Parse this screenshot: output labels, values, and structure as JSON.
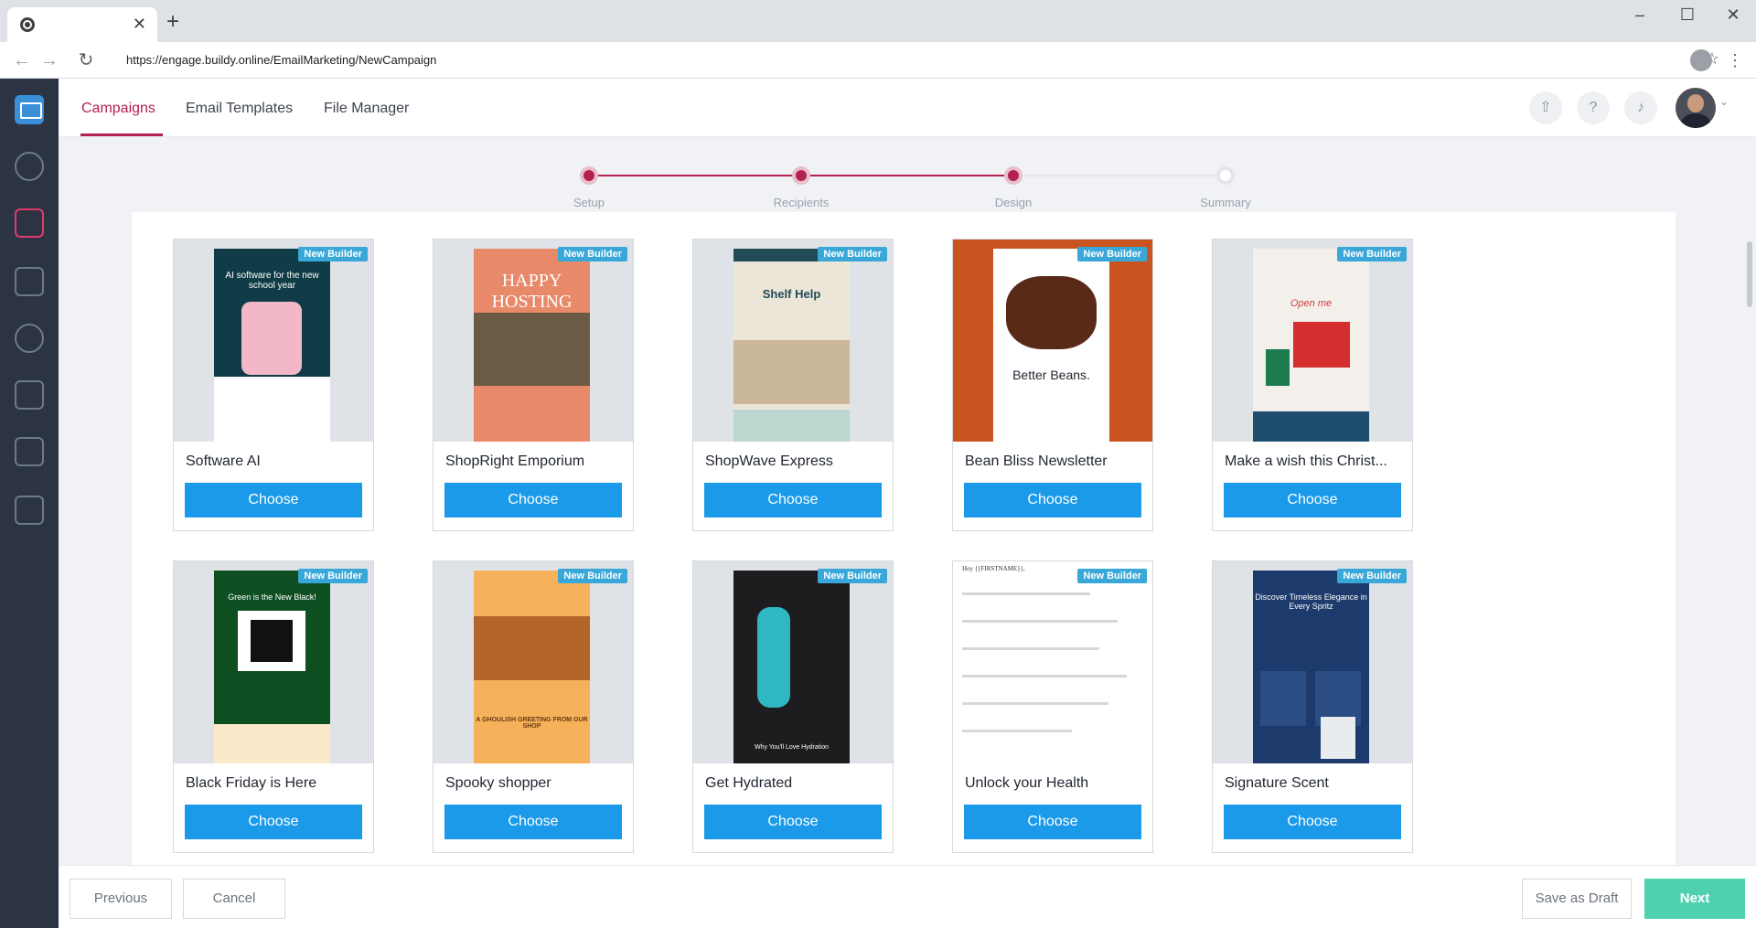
{
  "browser": {
    "url": "https://engage.buildy.online/EmailMarketing/NewCampaign",
    "new_tab": "+",
    "tab_close": "✕",
    "win_min": "–",
    "win_max": "☐",
    "win_close": "✕"
  },
  "header": {
    "tabs": [
      {
        "label": "Campaigns",
        "active": true
      },
      {
        "label": "Email Templates",
        "active": false
      },
      {
        "label": "File Manager",
        "active": false
      }
    ]
  },
  "stepper": {
    "steps": [
      {
        "label": "Setup",
        "complete": true
      },
      {
        "label": "Recipients",
        "complete": true
      },
      {
        "label": "Design",
        "complete": true
      },
      {
        "label": "Summary",
        "complete": false
      }
    ]
  },
  "templates": {
    "badge": "New Builder",
    "choose_label": "Choose",
    "items": [
      {
        "name": "Software AI",
        "thumb_text": "AI software for the new school year",
        "bg": "#0f3c46"
      },
      {
        "name": "ShopRight Emporium",
        "thumb_text": "HAPPY HOSTING",
        "bg": "#e8896a"
      },
      {
        "name": "ShopWave Express",
        "thumb_text": "Shelf Help",
        "bg": "#ece6d8"
      },
      {
        "name": "Bean Bliss Newsletter",
        "thumb_text": "Better Beans.",
        "bg": "#c9541f"
      },
      {
        "name": "Make a wish this Christ...",
        "thumb_text": "Open me",
        "bg": "#f3f0ec"
      },
      {
        "name": "Black Friday is Here",
        "thumb_text": "Green is the New Black!",
        "bg": "#0e4f22"
      },
      {
        "name": "Spooky shopper",
        "thumb_text": "A GHOULISH GREETING FROM OUR SHOP",
        "bg": "#f6b25a"
      },
      {
        "name": "Get Hydrated",
        "thumb_text": "Why You'll Love Hydration",
        "bg": "#1d1d1f"
      },
      {
        "name": "Unlock your Health",
        "thumb_text": "Hoy {{FIRSTNAME}},",
        "bg": "#ffffff"
      },
      {
        "name": "Signature Scent",
        "thumb_text": "Discover Timeless Elegance in Every Spritz",
        "bg": "#1c3a6b"
      }
    ]
  },
  "footer": {
    "previous": "Previous",
    "cancel": "Cancel",
    "save_draft": "Save as Draft",
    "next": "Next"
  },
  "colors": {
    "accent": "#b3214f",
    "choose": "#1a9ae8",
    "next": "#4fd1b0",
    "badge": "#39a7d8"
  }
}
